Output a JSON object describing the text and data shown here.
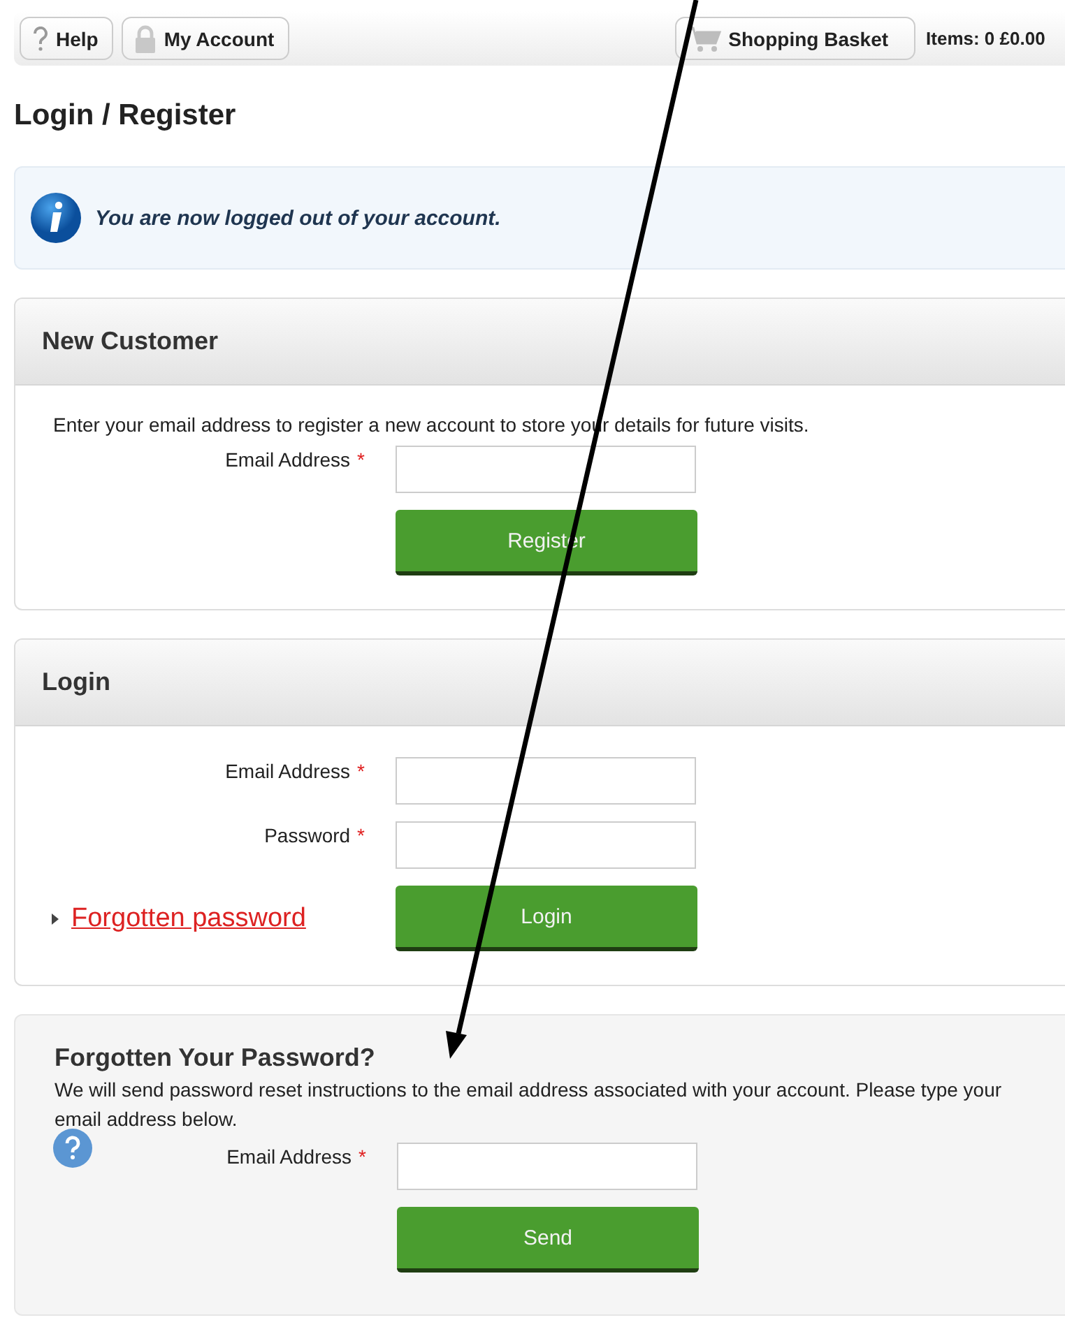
{
  "top_bar": {
    "buttons": [
      {
        "label": "Help",
        "kind": "help"
      },
      {
        "label": "My Account",
        "kind": "account"
      }
    ],
    "basket": {
      "label": "Shopping Basket"
    },
    "summary": "Items: 0 £0.00"
  },
  "page_title": "Login / Register",
  "notice": {
    "text": "You are now logged out of your account."
  },
  "panels": [
    {
      "kind": "boxed",
      "title": "New Customer",
      "intro": "Enter your email address to register a new account to store your details for future visits.",
      "fields": [
        {
          "label": "Email Address",
          "marker": "*"
        }
      ],
      "button": "Register"
    },
    {
      "kind": "boxed",
      "title": "Login",
      "fields": [
        {
          "label": "Email Address",
          "marker": "*"
        },
        {
          "label": "Password",
          "marker": "*"
        }
      ],
      "link": "Forgotten password",
      "button": "Login"
    },
    {
      "kind": "shaded",
      "title": "Forgotten Your Password?",
      "intro": "We will send password reset instructions to the email address associated with your account. Please type your email address below.",
      "help_icon": true,
      "fields": [
        {
          "label": "Email Address",
          "marker": "*"
        }
      ],
      "button": "Send"
    }
  ]
}
